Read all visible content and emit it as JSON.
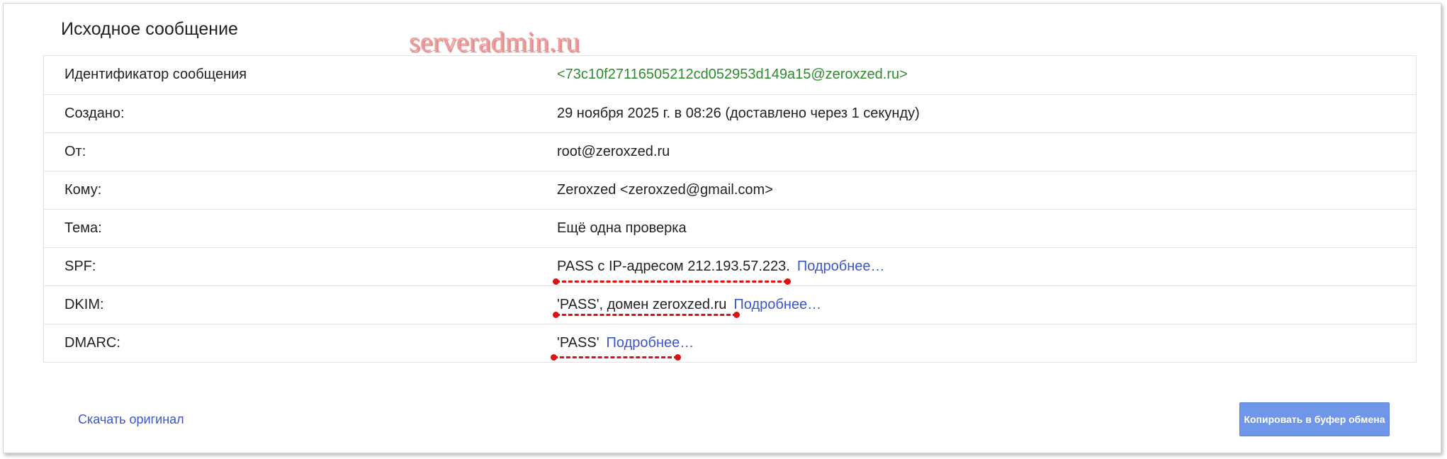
{
  "page": {
    "title": "Исходное сообщение",
    "watermark": "serveradmin.ru"
  },
  "rows": [
    {
      "label": "Идентификатор сообщения",
      "value": "<73c10f27116505212cd052953d149a15@zeroxzed.ru>"
    },
    {
      "label": "Создано:",
      "value": "29 ноября 2025 г. в 08:26 (доставлено через 1 секунду)"
    },
    {
      "label": "От:",
      "value": "root@zeroxzed.ru"
    },
    {
      "label": "Кому:",
      "value": "Zeroxzed <zeroxzed@gmail.com>"
    },
    {
      "label": "Тема:",
      "value": "Ещё одна проверка"
    },
    {
      "label": "SPF:",
      "value": "PASS с IP-адресом 212.193.57.223.",
      "link": "Подробнее…"
    },
    {
      "label": "DKIM:",
      "value": "'PASS', домен zeroxzed.ru",
      "link": "Подробнее…"
    },
    {
      "label": "DMARC:",
      "value": "'PASS'",
      "link": "Подробнее…"
    }
  ],
  "footer": {
    "download_label": "Скачать оригинал",
    "copy_label": "Копировать в буфер обмена"
  },
  "colors": {
    "message_id": "#2e8b2e",
    "link": "#3c55c8",
    "button": "#6f96e8",
    "annotation": "#e01010"
  }
}
